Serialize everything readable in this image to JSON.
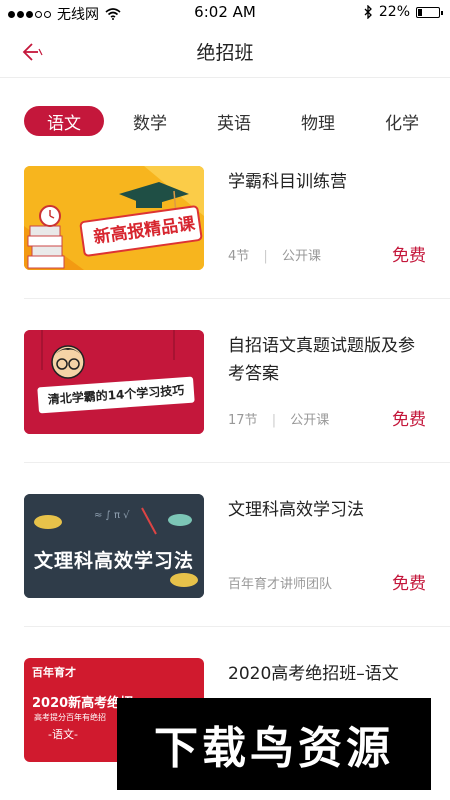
{
  "status_bar": {
    "carrier": "无线网",
    "time": "6:02 AM",
    "battery_percent": "22%",
    "battery_level": 0.22,
    "icons": [
      "signal-dots-icon",
      "wifi-icon",
      "bluetooth-icon",
      "battery-icon"
    ]
  },
  "header": {
    "title": "绝招班",
    "back_icon": "back-arrow-icon"
  },
  "tabs": [
    {
      "label": "语文",
      "active": true
    },
    {
      "label": "数学",
      "active": false
    },
    {
      "label": "英语",
      "active": false
    },
    {
      "label": "物理",
      "active": false
    },
    {
      "label": "化学",
      "active": false
    }
  ],
  "courses": [
    {
      "title": "学霸科目训练营",
      "thumb_text": "新高报精品课",
      "lessons": "4节",
      "type": "公开课",
      "price": "免费"
    },
    {
      "title": "自招语文真题试题版及参考答案",
      "thumb_text": "清北学霸的14个学习技巧",
      "lessons": "17节",
      "type": "公开课",
      "price": "免费"
    },
    {
      "title": "文理科高效学习法",
      "thumb_text": "文理科高效学习法",
      "teacher": "百年育才讲师团队",
      "price": "免费"
    },
    {
      "title": "2020高考绝招班–语文",
      "thumb_brand": "百年育才",
      "thumb_text": "2020新高考绝招",
      "thumb_sub": "高考提分百年有绝招",
      "thumb_tag": "-语文-"
    }
  ],
  "watermark": "下载鸟资源",
  "colors": {
    "accent": "#c4173b",
    "meta_text": "#999999"
  }
}
